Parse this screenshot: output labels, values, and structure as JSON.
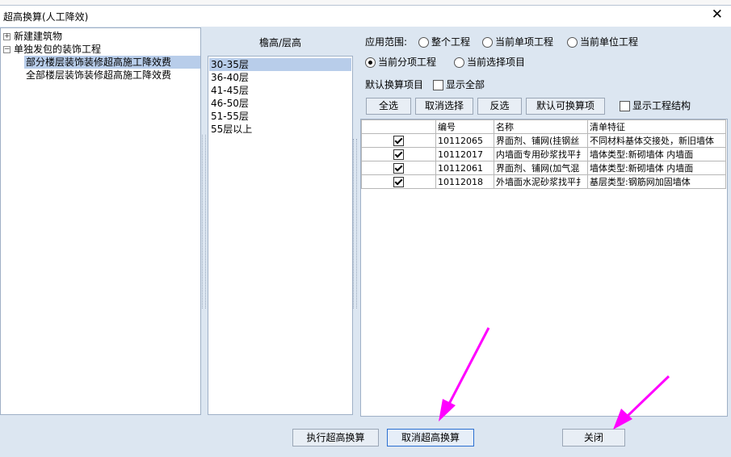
{
  "dialog": {
    "title": "超高换算(人工降效)",
    "close_symbol": "✕"
  },
  "tree": {
    "items": [
      {
        "label": "新建建筑物",
        "expander": "+"
      },
      {
        "label": "单独发包的装饰工程",
        "expander": "−"
      },
      {
        "label": "部分楼层装饰装修超高施工降效费"
      },
      {
        "label": "全部楼层装饰装修超高施工降效费"
      }
    ]
  },
  "heights": {
    "title": "檐高/层高",
    "items": [
      "30-35层",
      "36-40层",
      "41-45层",
      "46-50层",
      "51-55层",
      "55层以上"
    ]
  },
  "scope": {
    "label": "应用范围:",
    "options": [
      "整个工程",
      "当前单项工程",
      "当前单位工程",
      "当前分项工程",
      "当前选择项目"
    ],
    "selected": "当前分项工程"
  },
  "defaults": {
    "label": "默认换算项目",
    "show_all": "显示全部"
  },
  "toolbar": {
    "select_all": "全选",
    "cancel_select": "取消选择",
    "invert": "反选",
    "default_items": "默认可换算项",
    "show_structure": "显示工程结构"
  },
  "table": {
    "headers": [
      "",
      "编号",
      "名称",
      "清单特征"
    ],
    "rows": [
      {
        "checked": true,
        "code": "10112065",
        "name": "界面剂、铺网(挂钢丝",
        "feature": "不同材料基体交接处，新旧墙体"
      },
      {
        "checked": true,
        "code": "10112017",
        "name": "内墙面专用砂浆找平扌",
        "feature": "墙体类型:新砌墙体 内墙面"
      },
      {
        "checked": true,
        "code": "10112061",
        "name": "界面剂、铺网(加气混",
        "feature": "墙体类型:新砌墙体 内墙面"
      },
      {
        "checked": true,
        "code": "10112018",
        "name": "外墙面水泥砂浆找平扌",
        "feature": "基层类型:钢筋网加固墙体"
      }
    ]
  },
  "footer": {
    "execute": "执行超高换算",
    "cancel_conversion": "取消超高换算",
    "close": "关闭"
  },
  "colors": {
    "arrow": "#ff00ff",
    "selection": "#b8cdea",
    "dialog_bg": "#dce6f1"
  }
}
